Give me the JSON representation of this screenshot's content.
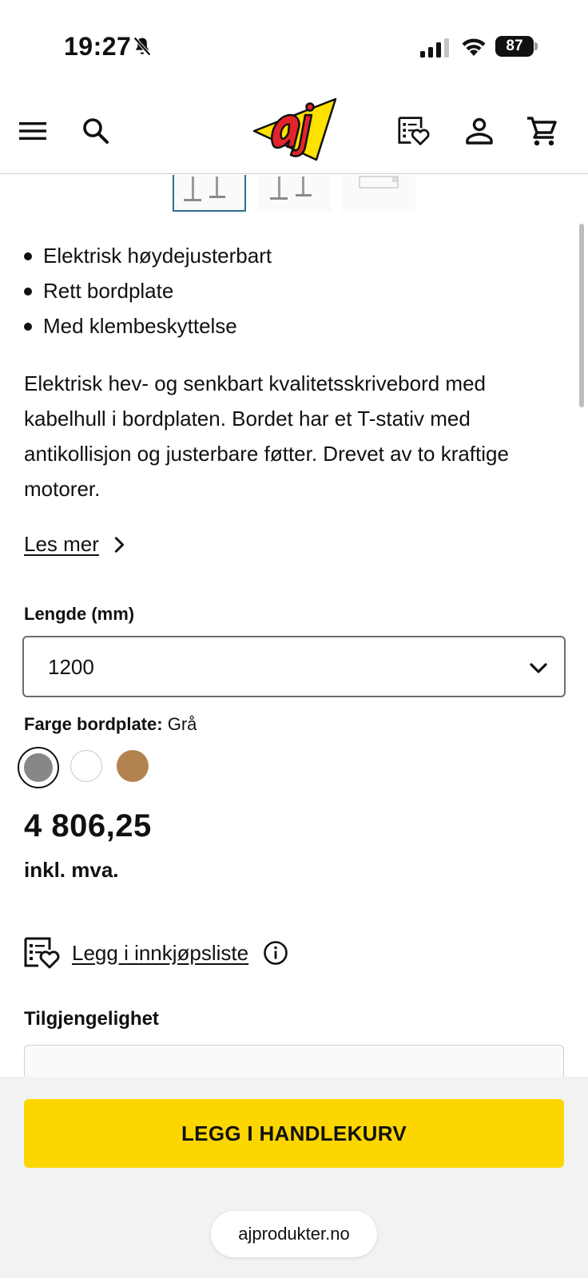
{
  "status_bar": {
    "time": "19:27",
    "battery": "87"
  },
  "header": {
    "logo_text": "AJ"
  },
  "product": {
    "bullets": [
      "Elektrisk høydejusterbart",
      "Rett bordplate",
      "Med klembeskyttelse"
    ],
    "description": "Elektrisk hev- og senkbart kvalitetsskrivebord med kabelhull i bordplaten. Bordet har et T-stativ med antikollisjon og justerbare føtter. Drevet av to kraftige motorer.",
    "read_more": "Les mer",
    "length": {
      "label": "Lengde (mm)",
      "value": "1200"
    },
    "color": {
      "label": "Farge bordplate:",
      "value": "Grå",
      "swatches": [
        {
          "name": "gray",
          "hex": "#878787",
          "selected": true
        },
        {
          "name": "white",
          "hex": "#ffffff",
          "selected": false
        },
        {
          "name": "oak",
          "hex": "#b3834f",
          "selected": false
        }
      ]
    },
    "price": "4 806,25",
    "vat_note": "inkl. mva.",
    "shopping_list_label": "Legg i innkjøpsliste",
    "availability_label": "Tilgjengelighet"
  },
  "cta": {
    "add_to_cart": "LEGG I HANDLEKURV"
  },
  "browser": {
    "url": "ajprodukter.no"
  },
  "colors": {
    "accent_yellow": "#fdd600",
    "logo_red": "#e3242b",
    "thumb_border": "#2a6f8f"
  }
}
